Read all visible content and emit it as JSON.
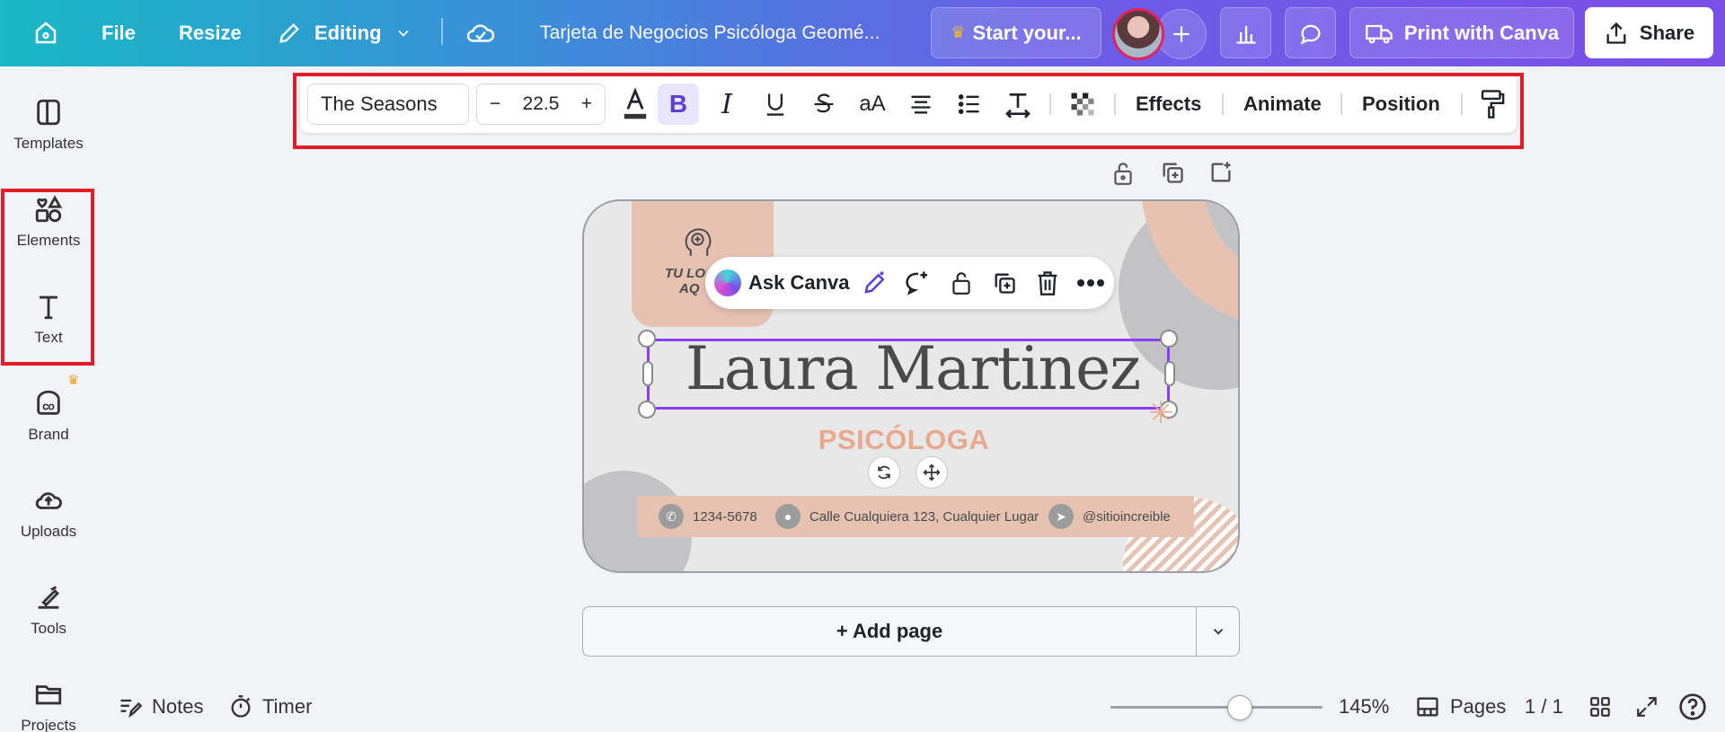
{
  "topbar": {
    "file": "File",
    "resize": "Resize",
    "editing": "Editing",
    "title": "Tarjeta de Negocios Psicóloga Geomé...",
    "start_trial": "Start your...",
    "print": "Print with Canva",
    "share": "Share"
  },
  "sidebar": {
    "items": [
      {
        "label": "Templates"
      },
      {
        "label": "Elements"
      },
      {
        "label": "Text"
      },
      {
        "label": "Brand"
      },
      {
        "label": "Uploads"
      },
      {
        "label": "Tools"
      },
      {
        "label": "Projects"
      }
    ]
  },
  "text_toolbar": {
    "font": "The Seasons",
    "size": "22.5",
    "minus": "−",
    "plus": "+",
    "case": "aA",
    "effects": "Effects",
    "animate": "Animate",
    "position": "Position"
  },
  "ask_canva": {
    "label": "Ask Canva"
  },
  "card": {
    "logo_text_1": "TU LO",
    "logo_text_2": "AQ",
    "name": "Laura Martinez",
    "subtitle": "PSICÓLOGA",
    "phone": "1234-5678",
    "address": "Calle Cualquiera 123, Cualquier Lugar",
    "web": "@sitioincreible"
  },
  "add_page": {
    "label": "+ Add page"
  },
  "bottom": {
    "notes": "Notes",
    "timer": "Timer",
    "zoom": "145%",
    "pages": "Pages",
    "page_count": "1 / 1",
    "zoom_level": 0.61
  },
  "colors": {
    "accent": "#8b3dff",
    "peach": "#e6c2b3",
    "subtitle": "#e8a98e",
    "highlight_box": "#e11d2a"
  }
}
